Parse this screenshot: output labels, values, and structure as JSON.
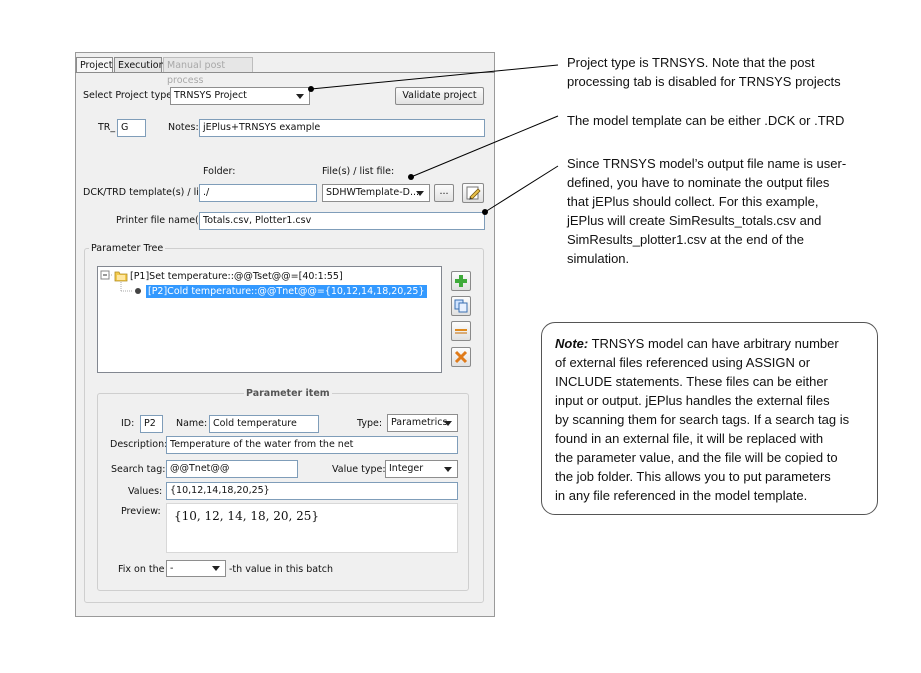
{
  "tabs": [
    {
      "label": "Project",
      "state": "active"
    },
    {
      "label": "Execution",
      "state": "normal"
    },
    {
      "label": "Manual post process",
      "state": "disabled"
    }
  ],
  "project": {
    "type_label": "Select Project type:",
    "type_value": "TRNSYS Project",
    "validate_label": "Validate project",
    "tr_label": "TR_",
    "tr_value": "G",
    "notes_label": "Notes:",
    "notes_value": "jEPlus+TRNSYS example",
    "folder_header": "Folder:",
    "files_header": "File(s) / list file:",
    "template_label": "DCK/TRD template(s) / list:",
    "folder_value": "./",
    "files_value": "SDHWTemplate-D...",
    "browse_label": "...",
    "printer_label": "Printer file name(s):",
    "printer_value": "Totals.csv, Plotter1.csv"
  },
  "tree": {
    "title": "Parameter Tree",
    "node1": "[P1]Set temperature::@@Tset@@=[40:1:55]",
    "node2": "[P2]Cold temperature::@@Tnet@@={10,12,14,18,20,25}"
  },
  "item": {
    "title": "Parameter item",
    "id_label": "ID:",
    "id_value": "P2",
    "name_label": "Name:",
    "name_value": "Cold temperature",
    "type_label": "Type:",
    "type_value": "Parametrics",
    "desc_label": "Description:",
    "desc_value": "Temperature of the water from the net",
    "tag_label": "Search tag:",
    "tag_value": "@@Tnet@@",
    "vtype_label": "Value type:",
    "vtype_value": "Integer",
    "values_label": "Values:",
    "values_value": "{10,12,14,18,20,25}",
    "preview_label": "Preview:",
    "preview_value": "{10, 12, 14, 18, 20, 25}",
    "fix_label": "Fix on the",
    "fix_value": "-",
    "fix_suffix": "-th value in this batch"
  },
  "annotations": {
    "a1": [
      "Project type is TRNSYS. Note that the post",
      "processing tab is disabled for TRNSYS projects"
    ],
    "a2": [
      "The model template can be either .DCK or .TRD"
    ],
    "a3": [
      "Since TRNSYS model’s output file name is user-",
      "defined, you have to nominate the output files",
      "that jEPlus should collect. For this example,",
      "jEPlus will create SimResults_totals.csv and",
      "SimResults_plotter1.csv at the end of the",
      "simulation."
    ],
    "note_bold": "Note:",
    "note_first_rest": " TRNSYS model can have arbitrary number",
    "note_rest": [
      "of external files referenced using ASSIGN or",
      "INCLUDE statements. These files can be either",
      "input or output. jEPlus handles the external files",
      "by scanning them for search tags. If a search tag is",
      "found in an external file, it will be replaced with",
      "the parameter value, and the file will be copied to",
      "the job folder. This allows you to put parameters",
      "in any file referenced in the model template."
    ]
  }
}
